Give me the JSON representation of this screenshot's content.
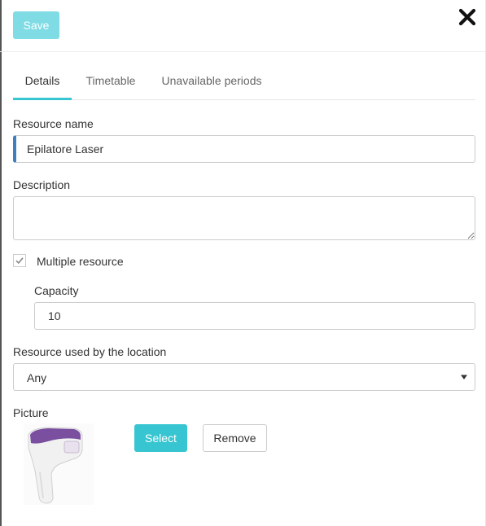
{
  "toolbar": {
    "save_label": "Save",
    "close_icon": "close-icon"
  },
  "tabs": [
    {
      "label": "Details",
      "active": true
    },
    {
      "label": "Timetable",
      "active": false
    },
    {
      "label": "Unavailable periods",
      "active": false
    }
  ],
  "form": {
    "resource_name": {
      "label": "Resource name",
      "value": "Epilatore Laser"
    },
    "description": {
      "label": "Description",
      "value": ""
    },
    "multiple_resource": {
      "label": "Multiple resource",
      "checked": true
    },
    "capacity": {
      "label": "Capacity",
      "value": "10"
    },
    "location": {
      "label": "Resource used by the location",
      "selected": "Any"
    },
    "picture": {
      "label": "Picture",
      "select_label": "Select",
      "remove_label": "Remove"
    }
  },
  "colors": {
    "accent": "#37c6d1",
    "accent_disabled": "#7fdbe4",
    "focus_bar": "#3f7fbf",
    "device_purple": "#7b4fa0"
  }
}
